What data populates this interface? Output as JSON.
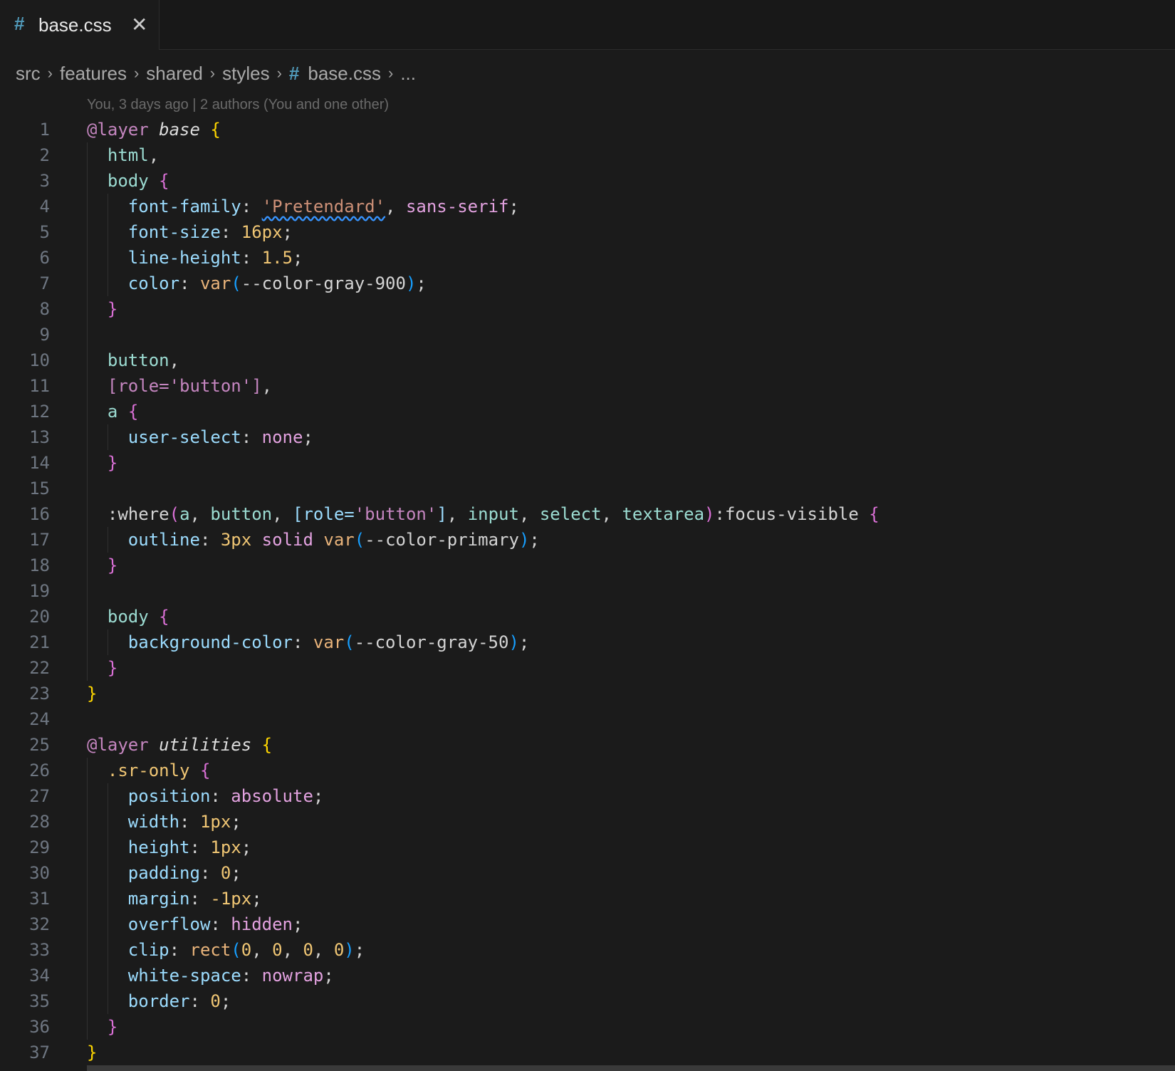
{
  "tab": {
    "icon": "#",
    "label": "base.css",
    "close": "✕"
  },
  "breadcrumb": {
    "src": "src",
    "features": "features",
    "shared": "shared",
    "styles": "styles",
    "file_icon": "#",
    "file": "base.css",
    "more": "...",
    "chevron": "›"
  },
  "blame": "You, 3 days ago | 2 authors (You and one other)",
  "lines": {
    "n": [
      "1",
      "2",
      "3",
      "4",
      "5",
      "6",
      "7",
      "8",
      "9",
      "10",
      "11",
      "12",
      "13",
      "14",
      "15",
      "16",
      "17",
      "18",
      "19",
      "20",
      "21",
      "22",
      "23",
      "24",
      "25",
      "26",
      "27",
      "28",
      "29",
      "30",
      "31",
      "32",
      "33",
      "34",
      "35",
      "36",
      "37"
    ],
    "l1": [
      "@layer",
      "base",
      "{"
    ],
    "l2": [
      "html",
      ","
    ],
    "l3": [
      "body",
      "{"
    ],
    "l4": [
      "font-family",
      ": ",
      "'Pretendard'",
      ", ",
      "sans-serif",
      ";"
    ],
    "l5": [
      "font-size",
      ": ",
      "16px",
      ";"
    ],
    "l6": [
      "line-height",
      ": ",
      "1.5",
      ";"
    ],
    "l7": [
      "color",
      ": ",
      "var",
      "(",
      "--color-gray-900",
      ")",
      ";"
    ],
    "l8": [
      "}"
    ],
    "l10": [
      "button",
      ","
    ],
    "l11": [
      "[role=",
      "'button'",
      "]",
      ","
    ],
    "l12": [
      "a",
      "{"
    ],
    "l13": [
      "user-select",
      ": ",
      "none",
      ";"
    ],
    "l14": [
      "}"
    ],
    "l16": [
      ":where",
      "(",
      "a",
      ", ",
      "button",
      ", ",
      "[role=",
      "'button'",
      "]",
      ", ",
      "input",
      ", ",
      "select",
      ", ",
      "textarea",
      ")",
      ":focus-visible",
      "{"
    ],
    "l17": [
      "outline",
      ": ",
      "3px",
      "solid",
      "var",
      "(",
      "--color-primary",
      ")",
      ";"
    ],
    "l18": [
      "}"
    ],
    "l20": [
      "body",
      "{"
    ],
    "l21": [
      "background-color",
      ": ",
      "var",
      "(",
      "--color-gray-50",
      ")",
      ";"
    ],
    "l22": [
      "}"
    ],
    "l23": [
      "}"
    ],
    "l25": [
      "@layer",
      "utilities",
      "{"
    ],
    "l26": [
      ".sr-only",
      "{"
    ],
    "l27": [
      "position",
      ": ",
      "absolute",
      ";"
    ],
    "l28": [
      "width",
      ": ",
      "1px",
      ";"
    ],
    "l29": [
      "height",
      ": ",
      "1px",
      ";"
    ],
    "l30": [
      "padding",
      ": ",
      "0",
      ";"
    ],
    "l31": [
      "margin",
      ": ",
      "-1px",
      ";"
    ],
    "l32": [
      "overflow",
      ": ",
      "hidden",
      ";"
    ],
    "l33": [
      "clip",
      ": ",
      "rect",
      "(",
      "0",
      ", ",
      "0",
      ", ",
      "0",
      ", ",
      "0",
      ")",
      ";"
    ],
    "l34": [
      "white-space",
      ": ",
      "nowrap",
      ";"
    ],
    "l35": [
      "border",
      ": ",
      "0",
      ";"
    ],
    "l36": [
      "}"
    ],
    "l37": [
      "}"
    ]
  },
  "colors": {
    "background": "#1b1b1b",
    "property": "#9cdcfe",
    "selector": "#9cdcd2",
    "string": "#ce9178",
    "number": "#f0c674",
    "value": "#e3a2e0",
    "bracket_gold": "#ffd700",
    "bracket_pink": "#da70d6",
    "bracket_blue": "#179fff"
  }
}
